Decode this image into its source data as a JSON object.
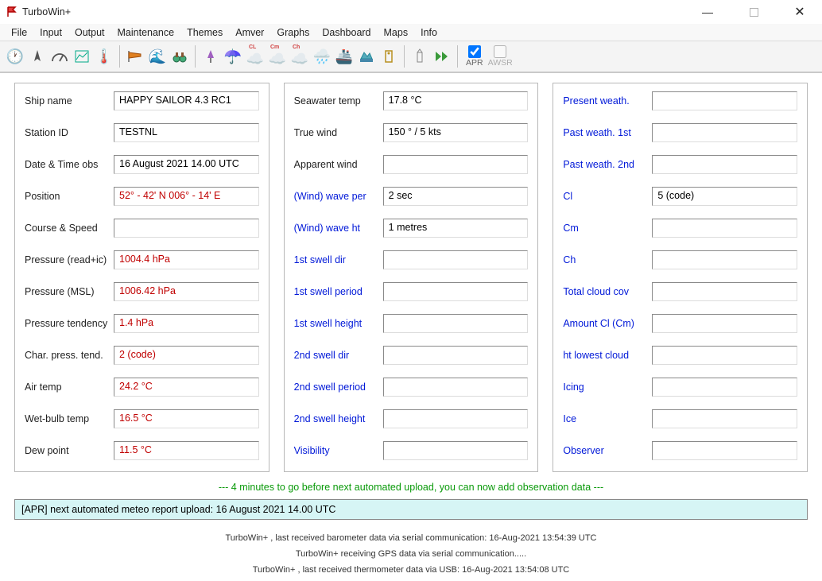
{
  "app": {
    "title": "TurboWin+"
  },
  "menu": [
    "File",
    "Input",
    "Output",
    "Maintenance",
    "Themes",
    "Amver",
    "Graphs",
    "Dashboard",
    "Maps",
    "Info"
  ],
  "toolbar_checks": {
    "apr": "APR",
    "awsr": "AWSR"
  },
  "panel1": [
    {
      "label": "Ship name",
      "value": "HAPPY SAILOR 4.3 RC1",
      "link": false,
      "red": false
    },
    {
      "label": "Station ID",
      "value": "TESTNL",
      "link": false,
      "red": false
    },
    {
      "label": "Date & Time obs",
      "value": "16 August 2021  14.00 UTC",
      "link": false,
      "red": false
    },
    {
      "label": "Position",
      "value": "52° - 42' N  006° - 14' E",
      "link": false,
      "red": true
    },
    {
      "label": "Course & Speed",
      "value": "",
      "link": false,
      "red": false
    },
    {
      "label": "Pressure (read+ic)",
      "value": "1004.4 hPa",
      "link": false,
      "red": true
    },
    {
      "label": "Pressure (MSL)",
      "value": "1006.42 hPa",
      "link": false,
      "red": true
    },
    {
      "label": "Pressure tendency",
      "value": "1.4 hPa",
      "link": false,
      "red": true
    },
    {
      "label": "Char. press. tend.",
      "value": "2 (code)",
      "link": false,
      "red": true
    },
    {
      "label": "Air temp",
      "value": "24.2 °C",
      "link": false,
      "red": true
    },
    {
      "label": "Wet-bulb temp",
      "value": "16.5 °C",
      "link": false,
      "red": true
    },
    {
      "label": "Dew point",
      "value": "11.5 °C",
      "link": false,
      "red": true
    }
  ],
  "panel2": [
    {
      "label": "Seawater temp",
      "value": "17.8 °C",
      "link": false
    },
    {
      "label": "True wind",
      "value": "150 ° / 5 kts",
      "link": false
    },
    {
      "label": "Apparent wind",
      "value": "",
      "link": false
    },
    {
      "label": "(Wind) wave per",
      "value": "2 sec",
      "link": true
    },
    {
      "label": "(Wind) wave ht",
      "value": "1 metres",
      "link": true
    },
    {
      "label": "1st swell dir",
      "value": "",
      "link": true
    },
    {
      "label": "1st swell period",
      "value": "",
      "link": true
    },
    {
      "label": "1st swell height",
      "value": "",
      "link": true
    },
    {
      "label": "2nd swell dir",
      "value": "",
      "link": true
    },
    {
      "label": "2nd swell period",
      "value": "",
      "link": true
    },
    {
      "label": "2nd swell height",
      "value": "",
      "link": true
    },
    {
      "label": "Visibility",
      "value": "",
      "link": true
    }
  ],
  "panel3": [
    {
      "label": "Present weath.",
      "value": "",
      "link": true
    },
    {
      "label": "Past weath. 1st",
      "value": "",
      "link": true
    },
    {
      "label": "Past weath. 2nd",
      "value": "",
      "link": true
    },
    {
      "label": "Cl",
      "value": "5 (code)",
      "link": true
    },
    {
      "label": "Cm",
      "value": "",
      "link": true
    },
    {
      "label": "Ch",
      "value": "",
      "link": true
    },
    {
      "label": "Total cloud cov",
      "value": "",
      "link": true
    },
    {
      "label": "Amount Cl (Cm)",
      "value": "",
      "link": true
    },
    {
      "label": "ht lowest cloud",
      "value": "",
      "link": true
    },
    {
      "label": "Icing",
      "value": "",
      "link": true
    },
    {
      "label": "Ice",
      "value": "",
      "link": true
    },
    {
      "label": "Observer",
      "value": "",
      "link": true
    }
  ],
  "green_msg": "--- 4 minutes to go before next automated upload, you can now add observation data ---",
  "status": "[APR] next automated meteo report upload: 16 August 2021 14.00 UTC",
  "footer": [
    "TurboWin+ , last received barometer data via serial communication: 16-Aug-2021 13:54:39 UTC",
    "TurboWin+ receiving GPS data via serial communication.....",
    "TurboWin+ , last received thermometer data via USB: 16-Aug-2021 13:54:08 UTC"
  ]
}
